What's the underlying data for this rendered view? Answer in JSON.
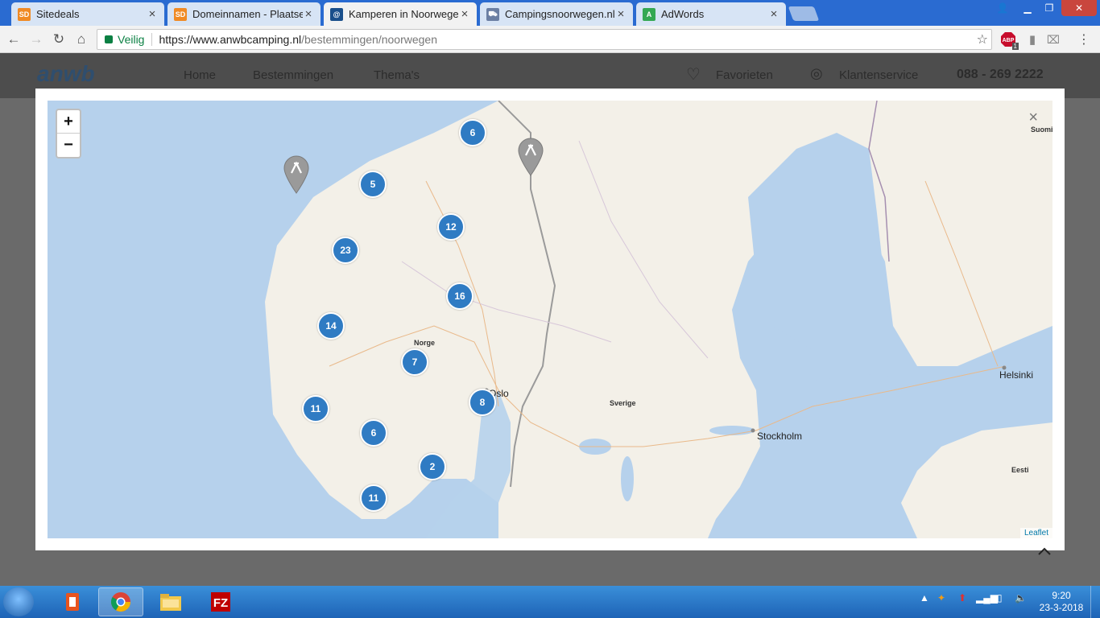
{
  "browser": {
    "tabs": [
      {
        "title": "Sitedeals",
        "favicon": "sd-icon",
        "fav_color": "#f08a24",
        "active": false
      },
      {
        "title": "Domeinnamen - Plaatsen",
        "favicon": "sd-icon",
        "fav_color": "#f08a24",
        "active": false
      },
      {
        "title": "Kamperen in Noorwegen",
        "favicon": "anwb-icon",
        "fav_color": "#1a4f8b",
        "active": true
      },
      {
        "title": "Campingsnoorwegen.nl -",
        "favicon": "cart-icon",
        "fav_color": "#6b7fa3",
        "active": false
      },
      {
        "title": "AdWords",
        "favicon": "adwords-icon",
        "fav_color": "#34a853",
        "active": false
      }
    ],
    "secure_label": "Veilig",
    "url_host": "https://www.anwbcamping.nl",
    "url_path": "/bestemmingen/noorwegen",
    "abp_badge": "1"
  },
  "site": {
    "logo": "anwb",
    "nav": [
      "Home",
      "Bestemmingen",
      "Thema's"
    ],
    "favorites": "Favorieten",
    "service": "Klantenservice",
    "phone": "088 - 269 2222"
  },
  "map": {
    "zoom_in": "+",
    "zoom_out": "−",
    "close": "×",
    "attribution": "Leaflet",
    "labels": {
      "norge": "Norge",
      "oslo": "Oslo",
      "sverige": "Sverige",
      "stockholm": "Stockholm",
      "helsinki": "Helsinki",
      "suomi": "Suomi",
      "eesti": "Eesti"
    },
    "clusters": [
      {
        "count": "6"
      },
      {
        "count": "5"
      },
      {
        "count": "12"
      },
      {
        "count": "23"
      },
      {
        "count": "16"
      },
      {
        "count": "14"
      },
      {
        "count": "7"
      },
      {
        "count": "8"
      },
      {
        "count": "11"
      },
      {
        "count": "6"
      },
      {
        "count": "2"
      },
      {
        "count": "11"
      }
    ]
  },
  "taskbar": {
    "time": "9:20",
    "date": "23-3-2018"
  }
}
